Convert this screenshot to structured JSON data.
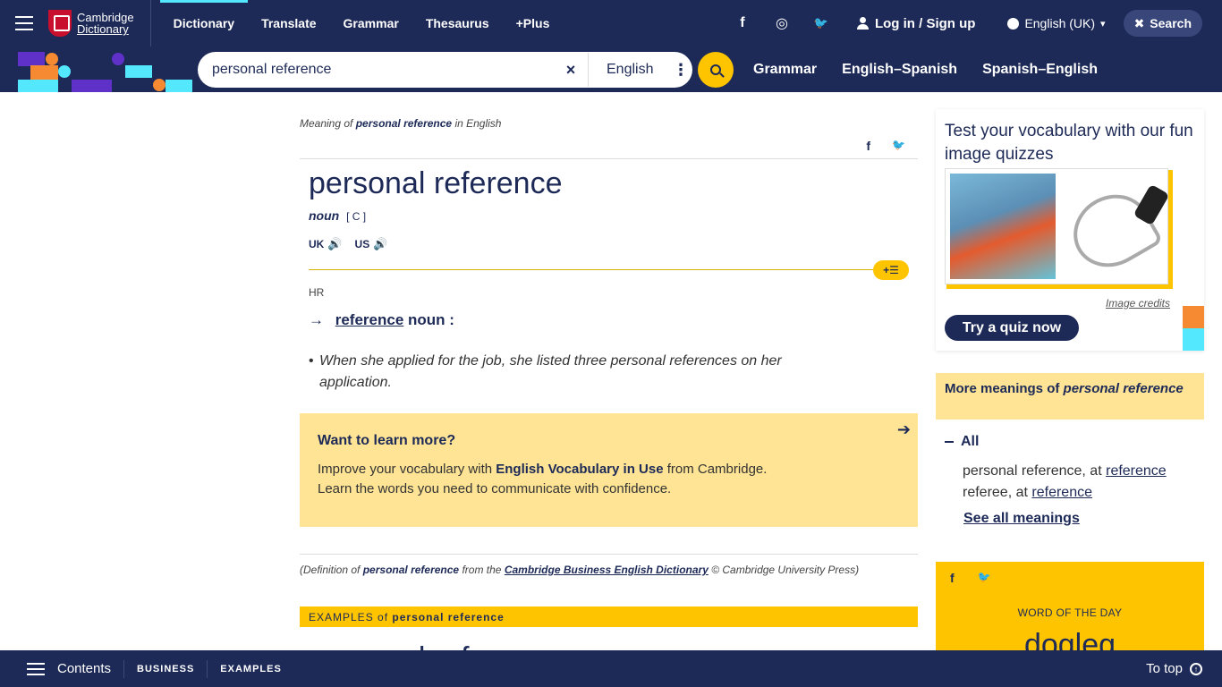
{
  "topnav": {
    "logo_line1": "Cambridge",
    "logo_line2": "Dictionary",
    "links": [
      "Dictionary",
      "Translate",
      "Grammar",
      "Thesaurus",
      "+Plus"
    ],
    "social": [
      "f",
      "◎",
      "🐦"
    ],
    "login": "Log in / Sign up",
    "language": "English (UK)",
    "search": "Search"
  },
  "searchbar": {
    "query": "personal reference",
    "clear": "×",
    "dict": "English",
    "dots": "⋮",
    "links": [
      "Grammar",
      "English–Spanish",
      "Spanish–English"
    ]
  },
  "entry": {
    "meaning_prefix": "Meaning of",
    "meaning_word": "personal reference",
    "meaning_suffix": "in English",
    "share": [
      "f",
      "🐦"
    ],
    "headword": "personal reference",
    "pos": "noun",
    "grammar": "[ C ]",
    "pron_uk": "UK",
    "pron_us": "US",
    "speaker": "🔊",
    "sense_btn": "+☰",
    "hr_label": "HR",
    "arrow": "→",
    "ref_word": "reference",
    "ref_pos": "noun :",
    "example": "When she applied for the job, she listed three personal references on her application."
  },
  "learn_box": {
    "title": "Want to learn more?",
    "text1": "Improve your vocabulary with",
    "bold": "English Vocabulary in Use",
    "text2": "from Cambridge.",
    "text3": "Learn the words you need to communicate with confidence.",
    "arrow": "➔"
  },
  "def_note": {
    "p1": "(Definition of",
    "word": "personal reference",
    "p2": "from the",
    "source": "Cambridge Business English Dictionary",
    "p3": "© Cambridge University Press)"
  },
  "examples": {
    "label": "EXAMPLES of",
    "word": "personal reference",
    "headword": "personal reference"
  },
  "quiz": {
    "title": "Test your vocabulary with our fun image quizzes",
    "credits": "Image credits",
    "button": "Try a quiz now"
  },
  "more": {
    "prefix": "More meanings of",
    "word": "personal reference",
    "all": "All",
    "items": [
      {
        "text": "personal reference, at",
        "link": "reference"
      },
      {
        "text": "referee, at",
        "link": "reference"
      }
    ],
    "see_all": "See all meanings"
  },
  "wotd": {
    "social": [
      "f",
      "🐦"
    ],
    "label": "WORD OF THE DAY",
    "word": "dogleg"
  },
  "footer": {
    "contents": "Contents",
    "tabs": [
      "BUSINESS",
      "EXAMPLES"
    ],
    "top": "To top",
    "up": "↑"
  },
  "colors": {
    "navy": "#1d2a57",
    "yellow": "#fec400",
    "light_yellow": "#fee494",
    "cyan": "#54e8ff",
    "orange": "#f58a32",
    "purple": "#5f31c9"
  }
}
